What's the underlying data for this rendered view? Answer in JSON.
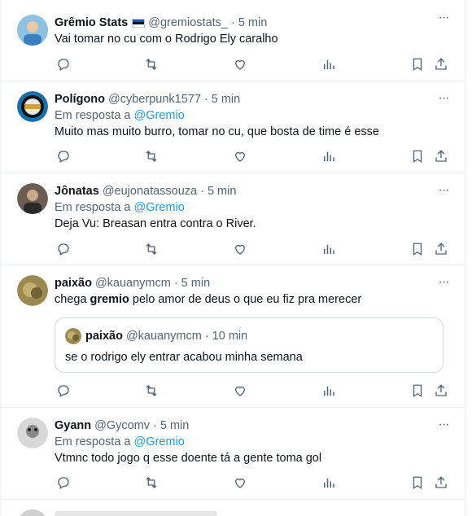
{
  "tweets": [
    {
      "name": "Grêmio Stats",
      "handle": "@gremiostats_",
      "time": "5 min",
      "text": "Vai tomar no cu com o Rodrigo Ely caralho",
      "avatar_color": "#7fb3d8"
    },
    {
      "name": "Polígono",
      "handle": "@cyberpunk1577",
      "time": "5 min",
      "reply_prefix": "Em resposta a",
      "reply_to": "@Gremio",
      "text": "Muito mas muito burro, tomar no cu, que bosta de time é esse",
      "avatar_color": "#1a6fa8"
    },
    {
      "name": "Jônatas",
      "handle": "@eujonatassouza",
      "time": "5 min",
      "reply_prefix": "Em resposta a",
      "reply_to": "@Gremio",
      "text": "Deja Vu: Breasan entra contra o River.",
      "avatar_color": "#5a4a3e"
    },
    {
      "name": "paixão",
      "handle": "@kauanymcm",
      "time": "5 min",
      "text_before": "chega ",
      "text_bold": "gremio",
      "text_after": " pelo amor de deus o que eu fiz pra merecer",
      "avatar_color": "#9a8a50",
      "quote": {
        "name": "paixão",
        "handle": "@kauanymcm",
        "time": "10 min",
        "text": "se o rodrigo ely entrar acabou minha semana"
      }
    },
    {
      "name": "Gyann",
      "handle": "@Gycomv",
      "time": "5 min",
      "reply_prefix": "Em resposta a",
      "reply_to": "@Gremio",
      "text": "Vtmnc todo jogo q esse doente tá a gente toma gol",
      "avatar_color": "#b8b8b8"
    }
  ],
  "icons": {
    "more": "more-icon",
    "reply": "reply-icon",
    "retweet": "retweet-icon",
    "like": "like-icon",
    "views": "views-icon",
    "bookmark": "bookmark-icon",
    "share": "share-icon"
  },
  "colors": {
    "accent": "#1d9bf0",
    "secondary_text": "#536471",
    "border": "#eff3f4"
  }
}
